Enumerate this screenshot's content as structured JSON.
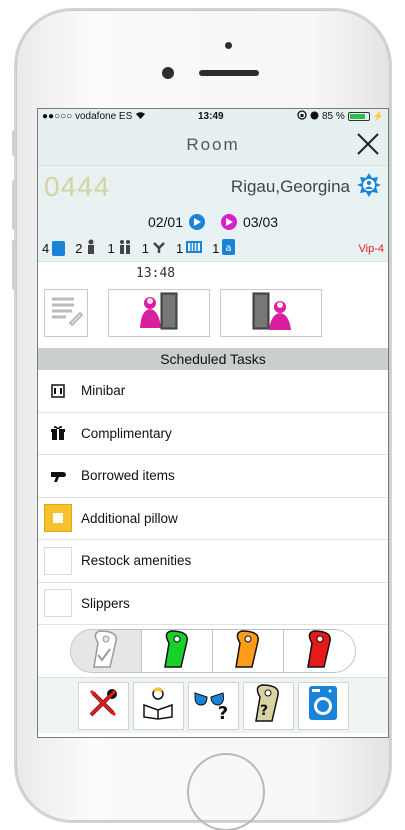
{
  "status_bar": {
    "carrier": "●●○○○ vodafone ES",
    "time": "13:49",
    "battery": "85 %",
    "battery_level": 0.85
  },
  "header": {
    "title": "Room",
    "close_icon": "close-icon"
  },
  "room": {
    "number": "0444",
    "guest_name": "Rigau,Georgina",
    "arrival": "02/01",
    "departure": "03/03",
    "occupancy": [
      {
        "icon": "adult-icon",
        "count": "4",
        "color": "#1a83d8"
      },
      {
        "icon": "person-icon",
        "count": "2",
        "color": "#444444"
      },
      {
        "icon": "couple-icon",
        "count": "1",
        "color": "#444444"
      },
      {
        "icon": "baby-icon",
        "count": "1",
        "color": "#444444"
      },
      {
        "icon": "crib-icon",
        "count": "1",
        "color": "#1a83d8"
      },
      {
        "icon": "extra-bed-icon",
        "count": "1",
        "color": "#1a83d8"
      }
    ],
    "vip": "Vip-4",
    "clock": "13:48"
  },
  "scheduled": {
    "title": "Scheduled Tasks",
    "tasks": [
      {
        "label": "Minibar",
        "icon": "minibar-icon"
      },
      {
        "label": "Complimentary",
        "icon": "gift-icon"
      },
      {
        "label": "Borrowed items",
        "icon": "hairdryer-icon"
      },
      {
        "label": "Additional pillow",
        "icon": "checkbox-checked"
      },
      {
        "label": "Restock amenities",
        "icon": "checkbox-empty"
      },
      {
        "label": "Slippers",
        "icon": "checkbox-empty"
      }
    ]
  },
  "colors": {
    "room_number": "#d3d4a3",
    "header_bg": "#e6f0f0",
    "accent_blue": "#1a83d8",
    "accent_magenta": "#d620c9",
    "vip_red": "#e02020",
    "hanger_green": "#18d12a",
    "hanger_orange": "#ff9c1a",
    "hanger_red": "#e61a1a"
  }
}
